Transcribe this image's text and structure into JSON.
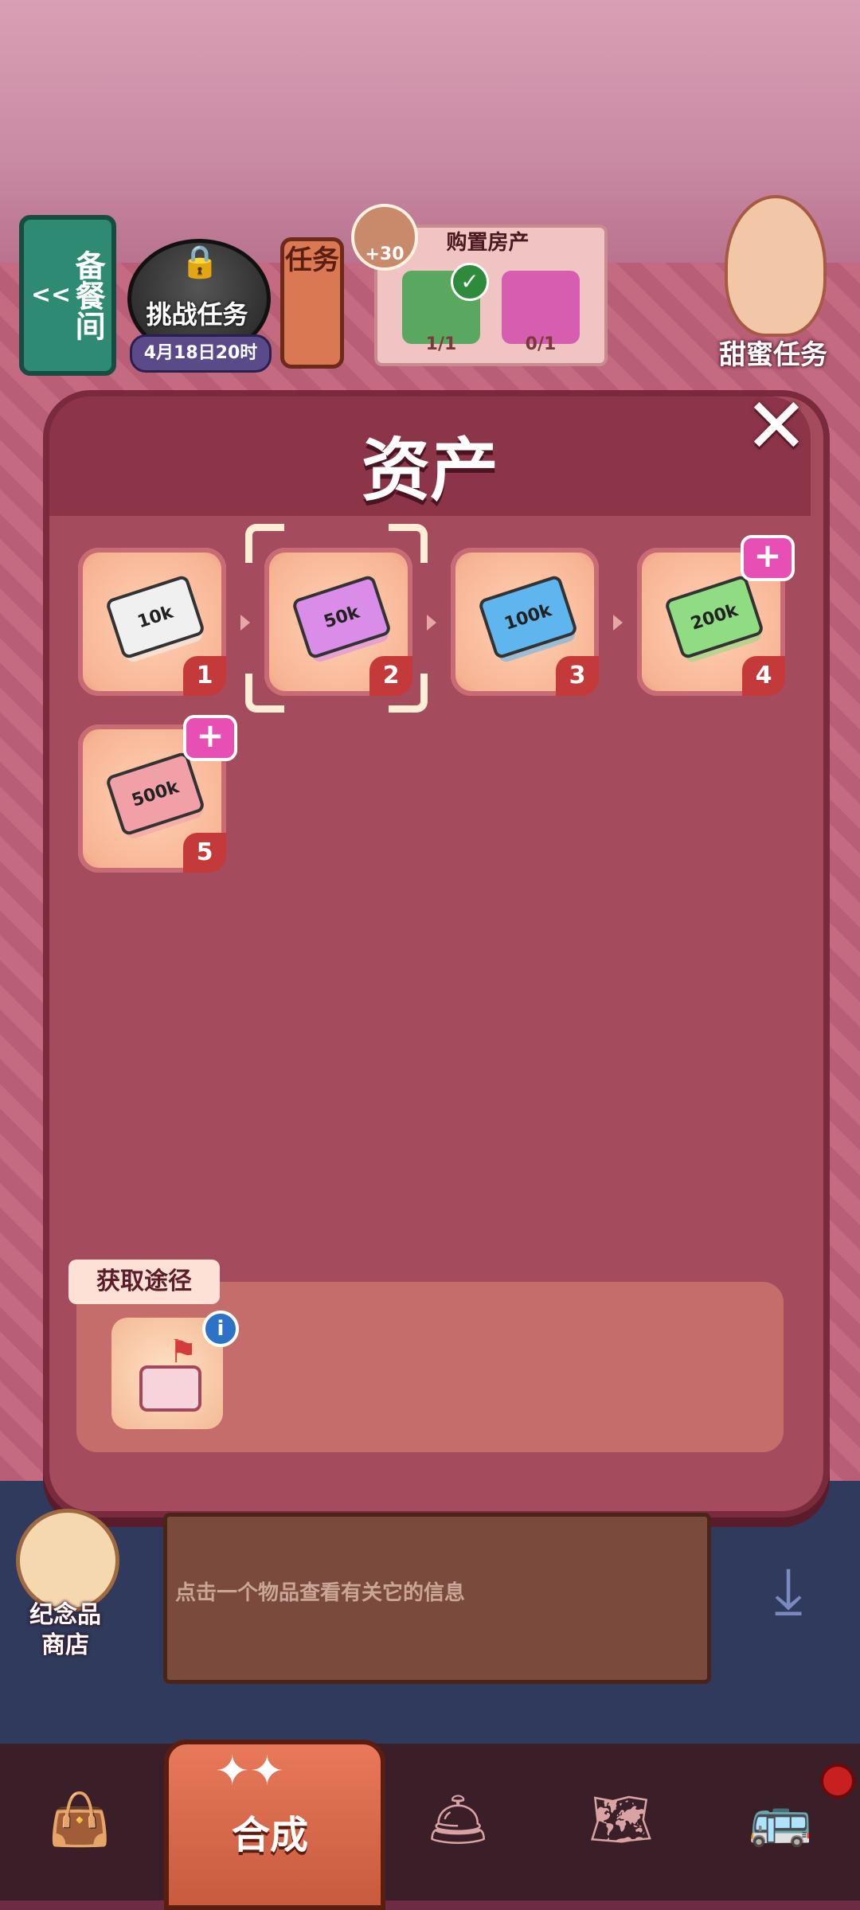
{
  "topbar": {
    "pantry_label": "备餐间",
    "pantry_arrow": "<<",
    "challenge_label": "挑战任务",
    "challenge_date": "4月18日20时",
    "task_label": "任务",
    "reward_amount": "+30",
    "purchase_title": "购置房产",
    "properties": [
      {
        "count": "1/1",
        "color": "#5aa860",
        "completed": true
      },
      {
        "count": "0/1",
        "color": "#d65db0",
        "completed": false
      }
    ],
    "sweet_task_label": "甜蜜任务"
  },
  "modal": {
    "title": "资产",
    "close_symbol": "✕",
    "items": [
      {
        "level": "1",
        "bill_text": "10k",
        "color": "#f0f0f0",
        "selected": false,
        "has_plus": false
      },
      {
        "level": "2",
        "bill_text": "50k",
        "color": "#d98ce8",
        "selected": true,
        "has_plus": false
      },
      {
        "level": "3",
        "bill_text": "100k",
        "color": "#5fb6ee",
        "selected": false,
        "has_plus": false
      },
      {
        "level": "4",
        "bill_text": "200k",
        "color": "#8fdc82",
        "selected": false,
        "has_plus": true
      },
      {
        "level": "5",
        "bill_text": "500k",
        "color": "#f2a0a8",
        "selected": false,
        "has_plus": true
      }
    ],
    "plus_symbol": "+",
    "source_label": "获取途径",
    "info_symbol": "i"
  },
  "info_panel": {
    "hint": "点击一个物品查看有关它的信息"
  },
  "souvenir": {
    "label_line1": "纪念品",
    "label_line2": "商店"
  },
  "nav": {
    "active_label": "合成"
  }
}
